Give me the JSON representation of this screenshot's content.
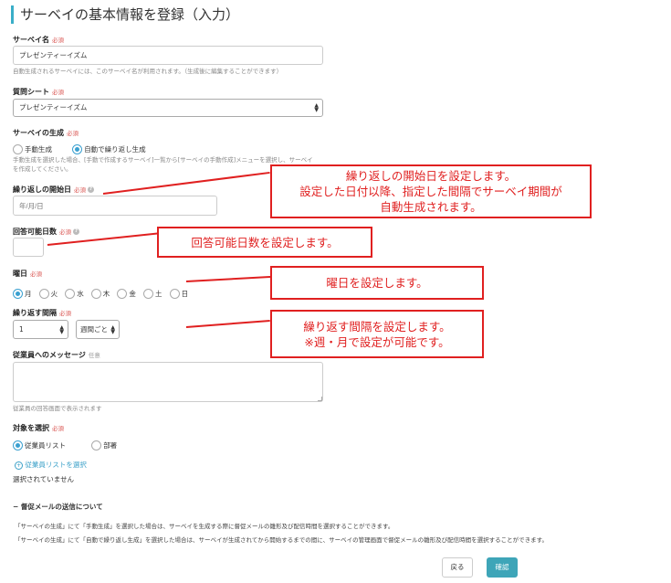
{
  "page_title": "サーベイの基本情報を登録（入力）",
  "survey_name": {
    "label": "サーベイ名",
    "required": "必須",
    "value": "プレゼンティーイズム",
    "note": "自動生成されるサーベイには、このサーベイ名が利用されます。（生成後に編集することができます）"
  },
  "questionnaire": {
    "label": "質問シート",
    "required": "必須",
    "selected": "プレゼンティーイズム"
  },
  "generation": {
    "label": "サーベイの生成",
    "required": "必須",
    "options": [
      "手動生成",
      "自動で繰り返し生成"
    ],
    "note_line1": "手動生成を選択した場合、[手動で作成するサーベイ]一覧から[サーベイの手動作成]メニューを選択し、サーベイ",
    "note_line2": "を作成してください。"
  },
  "start_date": {
    "label": "繰り返しの開始日",
    "required": "必須",
    "placeholder": "年/月/日"
  },
  "answer_days": {
    "label": "回答可能日数",
    "required": "必須"
  },
  "weekday": {
    "label": "曜日",
    "required": "必須",
    "days": [
      "月",
      "火",
      "水",
      "木",
      "金",
      "土",
      "日"
    ]
  },
  "interval": {
    "label": "繰り返す間隔",
    "required": "必須",
    "count": "1",
    "unit": "週間ごと"
  },
  "message": {
    "label": "従業員へのメッセージ",
    "optional": "任意",
    "note": "従業員の回答画面で表示されます"
  },
  "target": {
    "label": "対象を選択",
    "required": "必須",
    "options": [
      "従業員リスト",
      "部署"
    ],
    "select_link": "従業員リストを選択",
    "none_selected": "選択されていません"
  },
  "reminder": {
    "heading": "督促メールの送信について",
    "line1": "「サーベイの生成」にて「手動生成」を選択した場合は、サーベイを生成する際に督促メールの雛形及び配信時間を選択することができます。",
    "line2": "「サーベイの生成」にて「自動で繰り返し生成」を選択した場合は、サーベイが生成されてから開始するまでの間に、サーベイの管理画面で督促メールの雛形及び配信時間を選択することができます。"
  },
  "buttons": {
    "back": "戻る",
    "confirm": "確認"
  },
  "callouts": {
    "start_date": [
      "繰り返しの開始日を設定します。",
      "設定した日付以降、指定した間隔でサーベイ期間が",
      "自動生成されます。"
    ],
    "answer_days": "回答可能日数を設定します。",
    "weekday": "曜日を設定します。",
    "interval": [
      "繰り返す間隔を設定します。",
      "※週・月で設定が可能です。"
    ]
  },
  "colors": {
    "accent": "#3aaec8",
    "radio_selected": "#3aa0d0",
    "annotation_red": "#e02020",
    "required_red": "#d9534f",
    "confirm_button": "#3ea5b8"
  }
}
